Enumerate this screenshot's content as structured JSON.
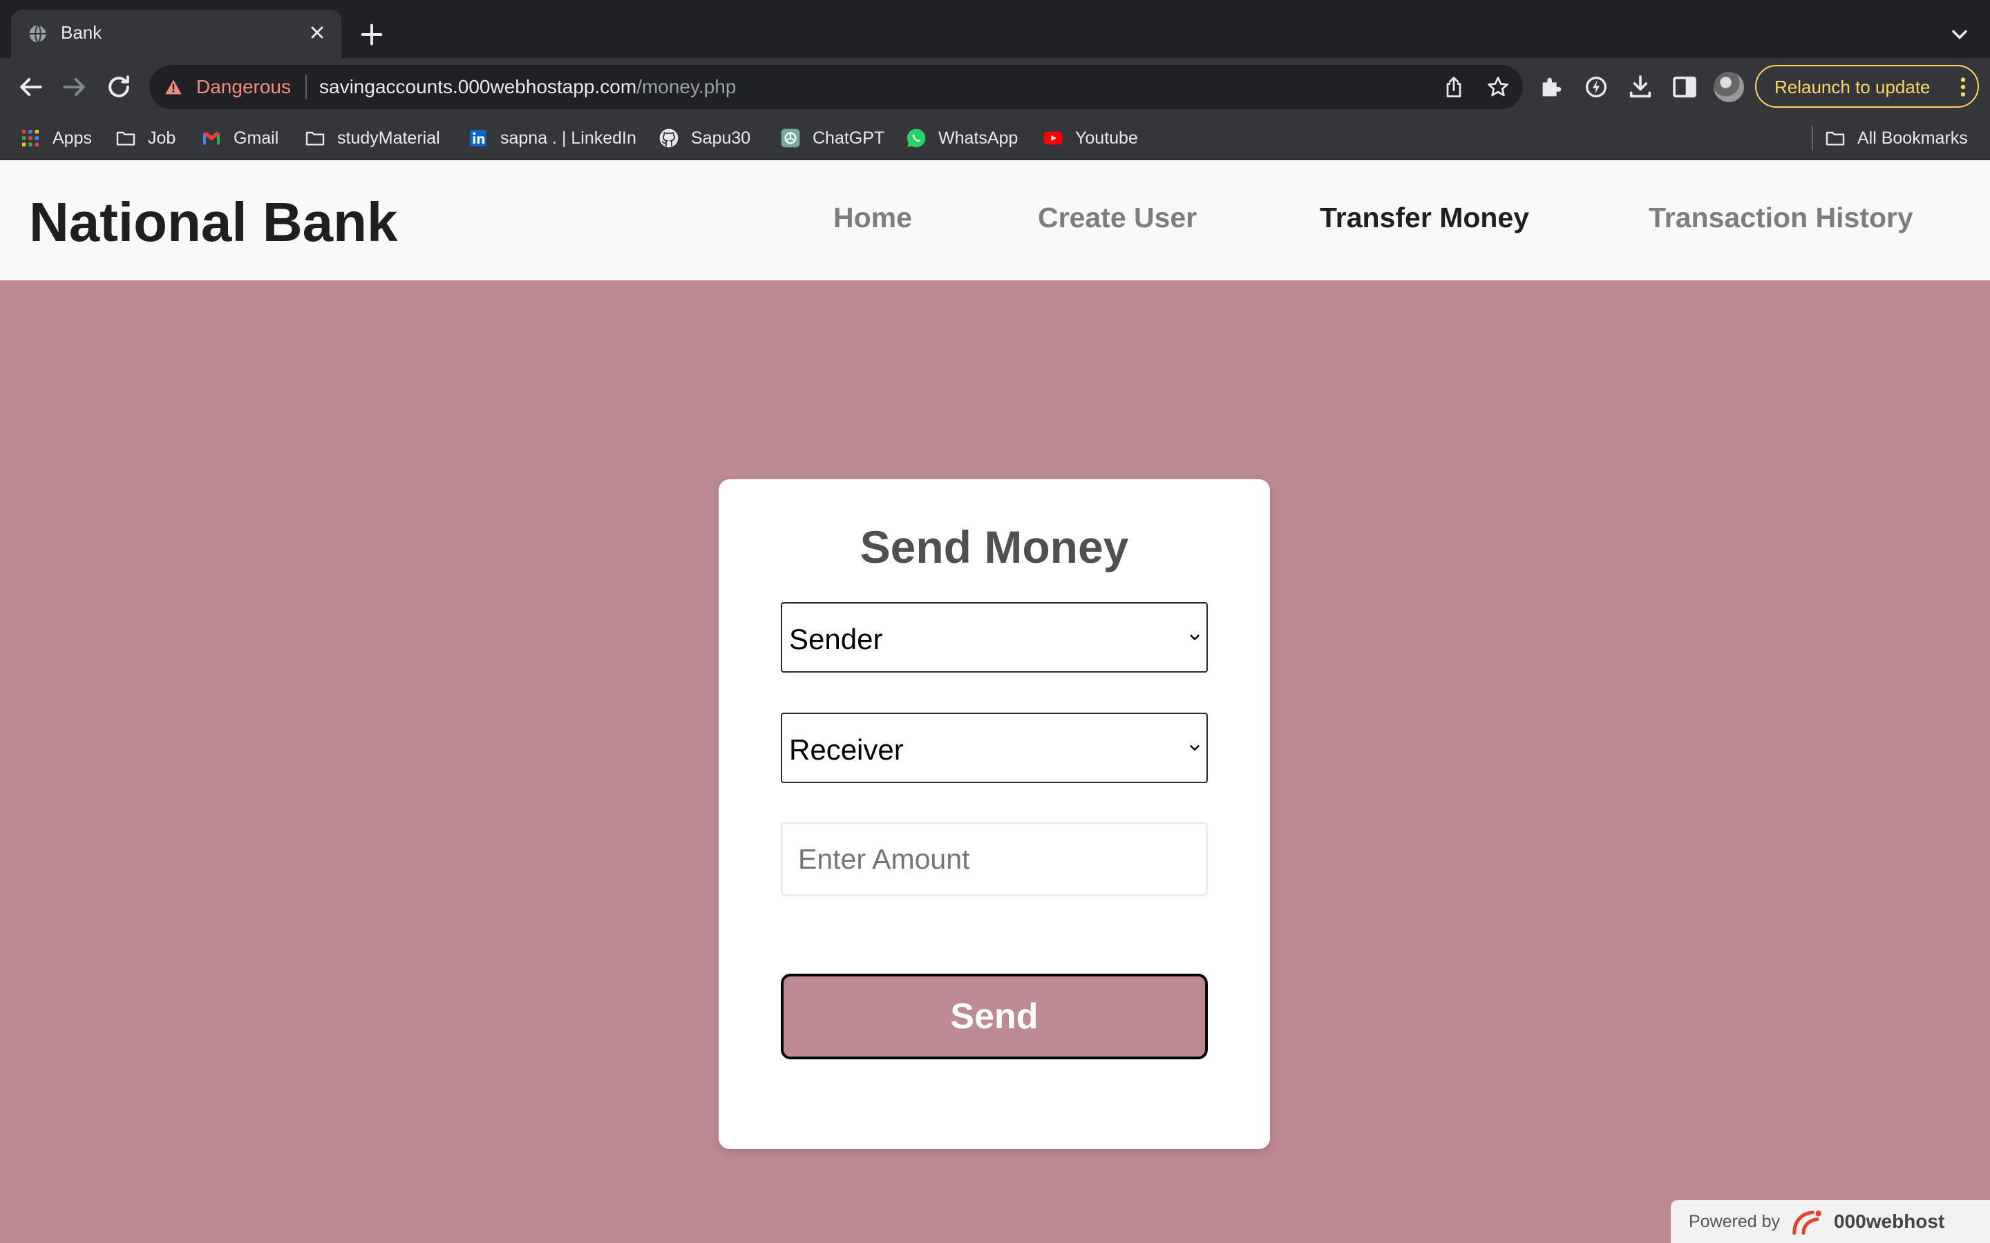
{
  "browser": {
    "tab": {
      "title": "Bank"
    },
    "address": {
      "security_label": "Dangerous",
      "host": "savingaccounts.000webhostapp.com",
      "path": "/money.php"
    },
    "relaunch_label": "Relaunch to update",
    "bookmarks": [
      {
        "label": "Apps",
        "icon": "apps-grid-icon"
      },
      {
        "label": "Job",
        "icon": "folder-icon"
      },
      {
        "label": "Gmail",
        "icon": "gmail-icon"
      },
      {
        "label": "studyMaterial",
        "icon": "folder-icon"
      },
      {
        "label": "sapna . | LinkedIn",
        "icon": "linkedin-icon"
      },
      {
        "label": "Sapu30",
        "icon": "github-icon"
      },
      {
        "label": "ChatGPT",
        "icon": "chatgpt-icon"
      },
      {
        "label": "WhatsApp",
        "icon": "whatsapp-icon"
      },
      {
        "label": "Youtube",
        "icon": "youtube-icon"
      }
    ],
    "all_bookmarks_label": "All Bookmarks"
  },
  "site": {
    "brand": "National Bank",
    "nav": [
      {
        "label": "Home",
        "active": false
      },
      {
        "label": "Create User",
        "active": false
      },
      {
        "label": "Transfer Money",
        "active": true
      },
      {
        "label": "Transaction History",
        "active": false
      }
    ]
  },
  "form": {
    "title": "Send Money",
    "sender_selected": "Sender",
    "receiver_selected": "Receiver",
    "amount_value": "",
    "amount_placeholder": "Enter Amount",
    "submit_label": "Send"
  },
  "footer": {
    "powered_by": "Powered by",
    "host_name": "000webhost"
  },
  "colors": {
    "page_background": "#bd8a92",
    "nav_background": "#f8f9fa",
    "danger_text": "#f28b82",
    "relaunch_accent": "#fdd663"
  }
}
